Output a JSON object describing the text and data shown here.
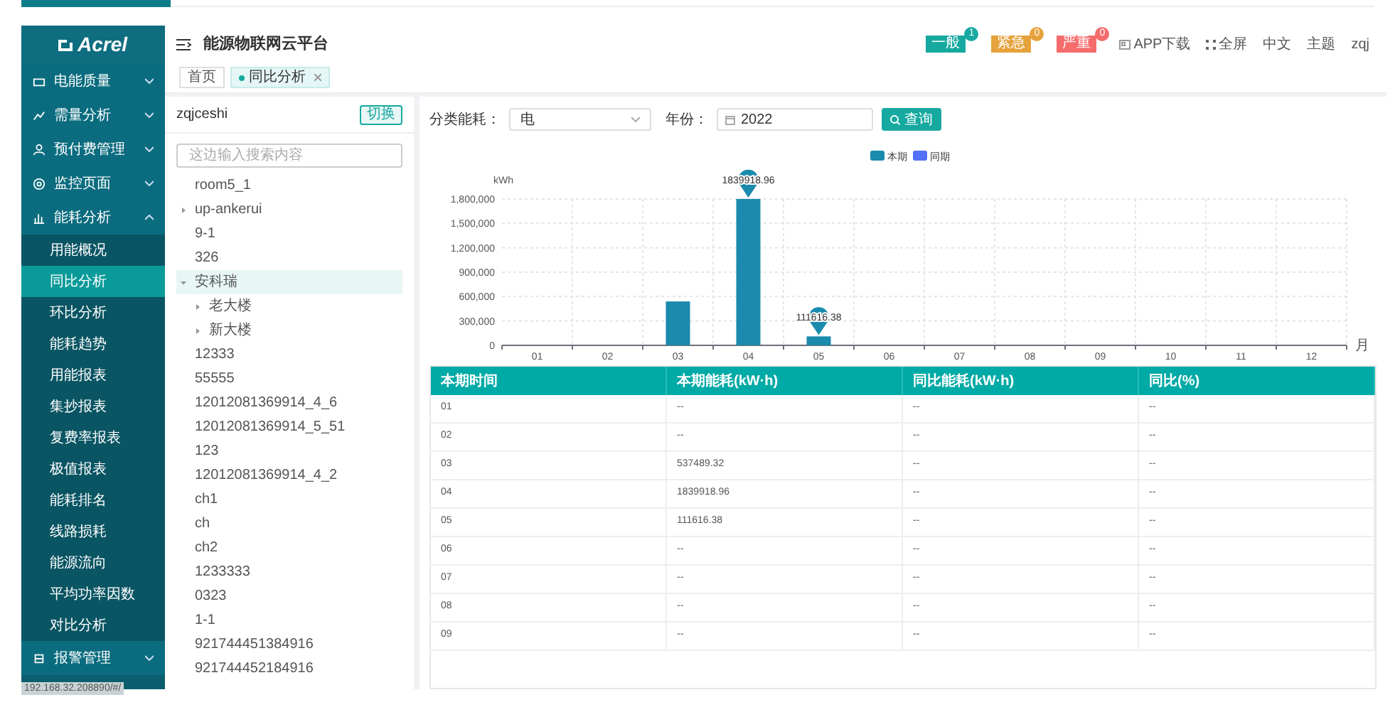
{
  "logo": "Acrel",
  "sidebar": {
    "items": [
      {
        "label": "电能质量",
        "expanded": false
      },
      {
        "label": "需量分析",
        "expanded": false
      },
      {
        "label": "预付费管理",
        "expanded": false
      },
      {
        "label": "监控页面",
        "expanded": false
      },
      {
        "label": "能耗分析",
        "expanded": true,
        "children": [
          {
            "label": "用能概况",
            "selected": false
          },
          {
            "label": "同比分析",
            "selected": true
          },
          {
            "label": "环比分析",
            "selected": false
          },
          {
            "label": "能耗趋势",
            "selected": false
          },
          {
            "label": "用能报表",
            "selected": false
          },
          {
            "label": "集抄报表",
            "selected": false
          },
          {
            "label": "复费率报表",
            "selected": false
          },
          {
            "label": "极值报表",
            "selected": false
          },
          {
            "label": "能耗排名",
            "selected": false
          },
          {
            "label": "线路损耗",
            "selected": false
          },
          {
            "label": "能源流向",
            "selected": false
          },
          {
            "label": "平均功率因数",
            "selected": false
          },
          {
            "label": "对比分析",
            "selected": false
          }
        ]
      },
      {
        "label": "报警管理",
        "expanded": false
      }
    ]
  },
  "status_url": "192.168.32.208890/#/",
  "header": {
    "title": "能源物联网云平台",
    "alarms": [
      {
        "label": "一般",
        "count": "1",
        "color": "#16a9a0"
      },
      {
        "label": "紧急",
        "count": "0",
        "color": "#e6a23c"
      },
      {
        "label": "严重",
        "count": "0",
        "color": "#f56c6c"
      }
    ],
    "links": [
      "APP下载",
      "全屏",
      "中文",
      "主题",
      "zqj"
    ]
  },
  "tabs": [
    {
      "label": "首页",
      "selected": false
    },
    {
      "label": "同比分析",
      "selected": true,
      "closable": true
    }
  ],
  "tree": {
    "project": "zqjceshi",
    "switch_button": "切换",
    "search": {
      "placeholder": "这边输入搜索内容"
    },
    "items": [
      {
        "label": "room5_1",
        "selected": false
      },
      {
        "label": "up-ankerui",
        "selected": false,
        "expanded": false
      },
      {
        "label": "9-1",
        "selected": false
      },
      {
        "label": "326",
        "selected": false
      },
      {
        "label": "安科瑞",
        "selected": true,
        "expanded": true,
        "children": [
          {
            "label": "老大楼",
            "selected": false,
            "expanded": false
          },
          {
            "label": "新大楼",
            "selected": false,
            "expanded": false
          }
        ]
      },
      {
        "label": "12333",
        "selected": false
      },
      {
        "label": "55555",
        "selected": false
      },
      {
        "label": "12012081369914_4_6",
        "selected": false
      },
      {
        "label": "12012081369914_5_51",
        "selected": false
      },
      {
        "label": "123",
        "selected": false
      },
      {
        "label": "12012081369914_4_2",
        "selected": false
      },
      {
        "label": "ch1",
        "selected": false
      },
      {
        "label": "ch",
        "selected": false
      },
      {
        "label": "ch2",
        "selected": false
      },
      {
        "label": "1233333",
        "selected": false
      },
      {
        "label": "0323",
        "selected": false
      },
      {
        "label": "1-1",
        "selected": false
      },
      {
        "label": "921744451384916",
        "selected": false
      },
      {
        "label": "921744452184916",
        "selected": false
      }
    ]
  },
  "filters": {
    "category_label": "分类能耗：",
    "category_value": "电",
    "year_label": "年份：",
    "year_value": "2022",
    "query_button": "查询"
  },
  "chart_data": {
    "type": "bar",
    "ylabel": "kWh",
    "xlabel": "月",
    "categories": [
      "01",
      "02",
      "03",
      "04",
      "05",
      "06",
      "07",
      "08",
      "09",
      "10",
      "11",
      "12"
    ],
    "series": [
      {
        "name": "本期",
        "color": "#1a8aad",
        "values": [
          null,
          null,
          540000,
          1800000,
          110000,
          null,
          null,
          null,
          null,
          null,
          null,
          null
        ]
      },
      {
        "name": "同期",
        "color": "#5470f5",
        "values": [
          null,
          null,
          null,
          null,
          null,
          null,
          null,
          null,
          null,
          null,
          null,
          null
        ]
      }
    ],
    "ylim": [
      0,
      1800000
    ],
    "grid": true,
    "yticks": [
      {
        "value": 0,
        "label": "0"
      },
      {
        "value": 300000,
        "label": "300,000"
      },
      {
        "value": 600000,
        "label": "600,000"
      },
      {
        "value": 900000,
        "label": "900,000"
      },
      {
        "value": 1200000,
        "label": "1,200,000"
      },
      {
        "value": 1500000,
        "label": "1,500,000"
      },
      {
        "value": 1800000,
        "label": "1,800,000"
      }
    ],
    "annotations": [
      "1839918.96",
      "111616.38"
    ]
  },
  "table": {
    "columns": [
      "本期时间",
      "本期能耗(kW·h)",
      "同比能耗(kW·h)",
      "同比(%)"
    ],
    "rows": [
      [
        "01",
        "--",
        "--",
        "--"
      ],
      [
        "02",
        "--",
        "--",
        "--"
      ],
      [
        "03",
        "537489.32",
        "--",
        "--"
      ],
      [
        "04",
        "1839918.96",
        "--",
        "--"
      ],
      [
        "05",
        "111616.38",
        "--",
        "--"
      ],
      [
        "06",
        "--",
        "--",
        "--"
      ],
      [
        "07",
        "--",
        "--",
        "--"
      ],
      [
        "08",
        "--",
        "--",
        "--"
      ],
      [
        "09",
        "--",
        "--",
        "--"
      ]
    ]
  }
}
